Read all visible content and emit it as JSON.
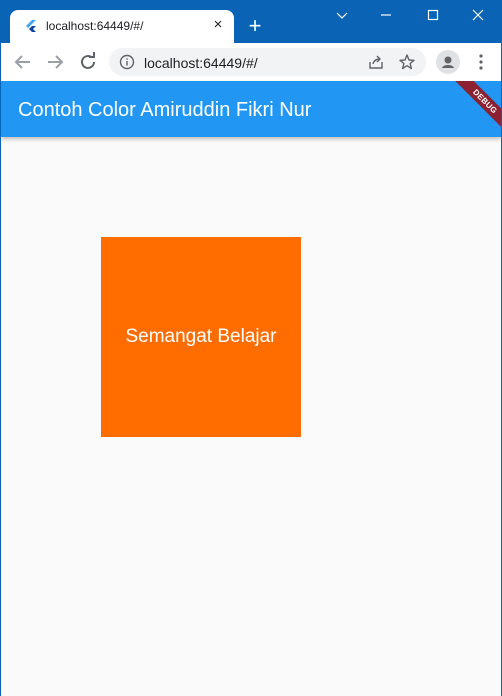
{
  "browser": {
    "tab": {
      "title": "localhost:64449/#/",
      "favicon": "flutter-icon",
      "close": "×"
    },
    "new_tab": "+",
    "url": "localhost:64449/#/",
    "colors": {
      "frame": "#0b63b6",
      "omnibox": "#f1f3f4"
    }
  },
  "app": {
    "appbar_title": "Contoh Color Amiruddin Fikri Nur",
    "debug_banner": "DEBUG",
    "box_text": "Semangat Belajar",
    "colors": {
      "appbar": "#2196f3",
      "box": "#ff6d00",
      "background": "#fafafa",
      "banner": "#8b2131"
    }
  }
}
